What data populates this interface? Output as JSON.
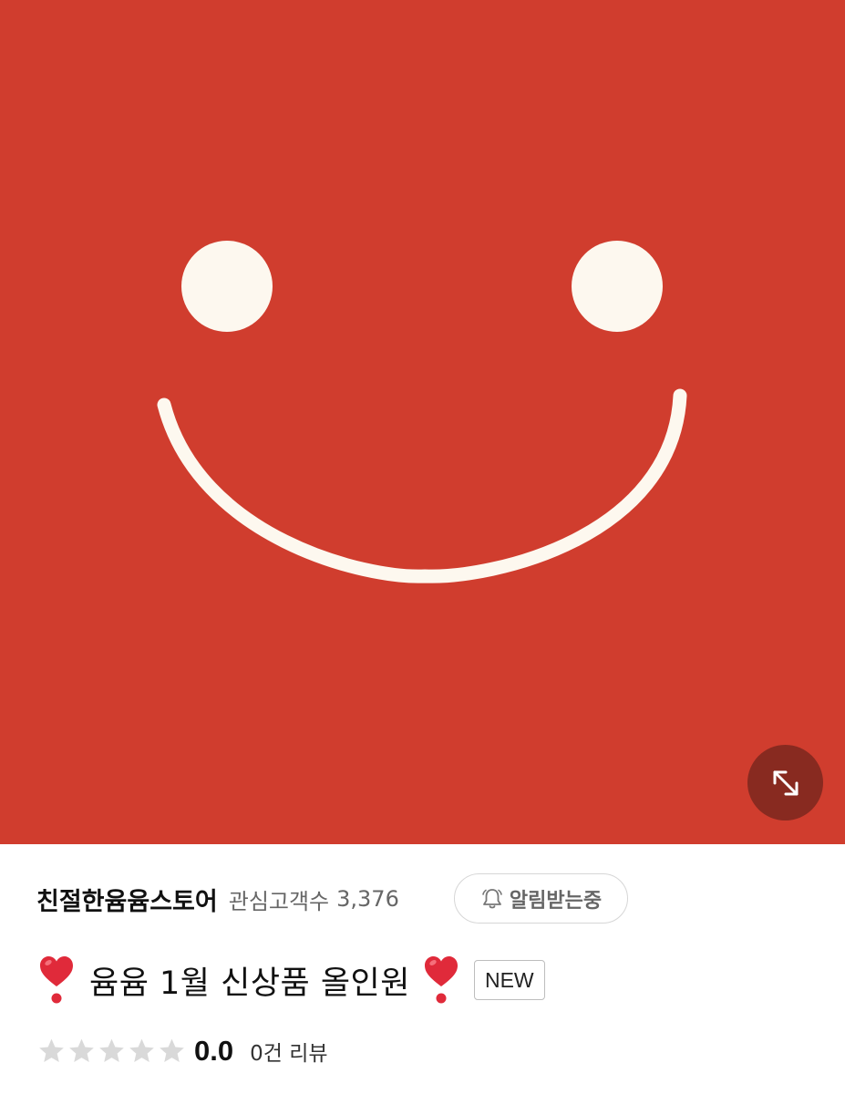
{
  "hero": {
    "background_color": "#d03d2e",
    "face_color": "#fdf8ef",
    "expand_icon": "expand-arrows-icon"
  },
  "store": {
    "name": "친절한윰윰스토어",
    "follower_label": "관심고객수",
    "follower_count": "3,376",
    "notify_label": "알림받는중",
    "notify_icon": "bell-icon"
  },
  "product": {
    "title": "윰윰 1월 신상품 올인원",
    "badge": "NEW",
    "heart_icon": "red-heart-exclamation-icon",
    "heart_color": "#e02a3a"
  },
  "rating": {
    "stars_total": 5,
    "stars_filled": 0,
    "value": "0.0",
    "review_count": "0건 리뷰"
  }
}
